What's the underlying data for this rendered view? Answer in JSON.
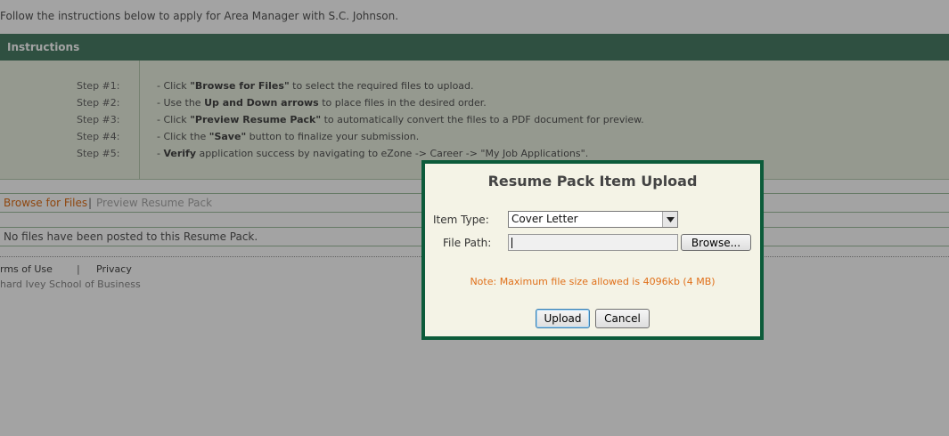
{
  "page": {
    "intro": "Follow the instructions below to apply for Area Manager with S.C. Johnson.",
    "instructions_title": "Instructions",
    "steps": [
      {
        "label": "Step #1:",
        "parts": [
          "- Click ",
          "\"Browse for Files\"",
          " to select the required files to upload."
        ]
      },
      {
        "label": "Step #2:",
        "parts": [
          "- Use the ",
          "Up and Down arrows",
          " to place files in the desired order."
        ]
      },
      {
        "label": "Step #3:",
        "parts": [
          "- Click ",
          "\"Preview Resume Pack\"",
          " to automatically convert the files to a PDF document for preview."
        ]
      },
      {
        "label": "Step #4:",
        "parts": [
          "- Click the ",
          "\"Save\"",
          " button to finalize your submission."
        ]
      },
      {
        "label": "Step #5:",
        "parts": [
          "- ",
          "Verify",
          " application success by navigating to eZone -> Career -> \"My Job Applications\"."
        ]
      }
    ],
    "links": {
      "browse": "Browse for Files",
      "separator": "|",
      "preview": "Preview Resume Pack"
    },
    "files_status": "No files have been posted to this Resume Pack.",
    "footer": {
      "terms": "rms of Use",
      "separator": "|",
      "privacy": "Privacy",
      "copyright": "hard Ivey School of Business"
    }
  },
  "modal": {
    "title": "Resume Pack Item Upload",
    "item_type_label": "Item Type:",
    "item_type_value": "Cover Letter",
    "file_path_label": "File Path:",
    "file_path_value": "",
    "browse_label": "Browse...",
    "note": "Note: Maximum file size allowed is 4096kb (4 MB)",
    "upload_label": "Upload",
    "cancel_label": "Cancel"
  },
  "colors": {
    "header": "#4a7e67",
    "modal_border": "#0c5b3a",
    "note": "#e0701a",
    "link": "#e0701a"
  }
}
